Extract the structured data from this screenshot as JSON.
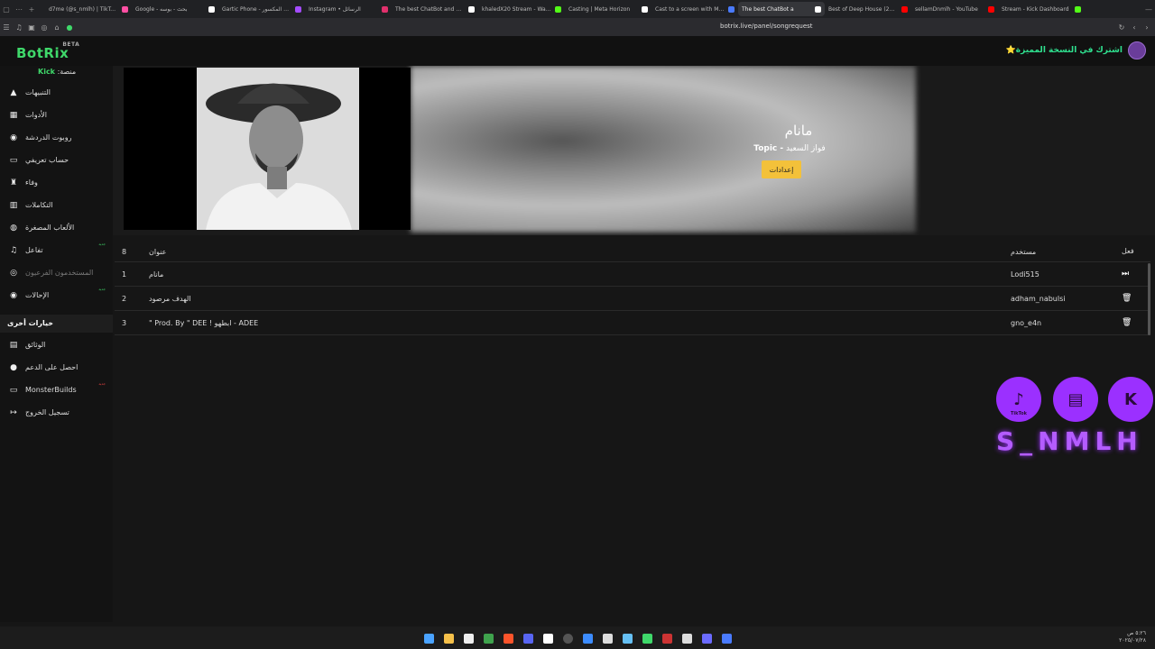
{
  "browser": {
    "tabs": [
      {
        "label": "d7me (@s_nmlh) | TikTok (5)",
        "color": "#ff4fa3"
      },
      {
        "label": "Google - بحث - بوسه",
        "color": "#ffffff"
      },
      {
        "label": "Gartic Phone - الهاتف المكسور",
        "color": "#a44cff"
      },
      {
        "label": "Instagram • الرسائل",
        "color": "#e1306c"
      },
      {
        "label": "The best ChatBot and Widg",
        "color": "#ffffff"
      },
      {
        "label": "khaledX20 Stream - Watch",
        "color": "#53fc18"
      },
      {
        "label": "Casting | Meta Horizon",
        "color": "#ffffff"
      },
      {
        "label": "Cast to a screen with Meta",
        "color": "#4a7bff"
      },
      {
        "label": "The best ChatBot a",
        "color": "#ffffff"
      },
      {
        "label": "Best of Deep House (2025)",
        "color": "#ff0000"
      },
      {
        "label": "sellamDnmlh - YouTube",
        "color": "#ff0000"
      },
      {
        "label": "Stream - Kick Dashboard",
        "color": "#53fc18"
      }
    ],
    "url": "botrix.live/panel/songrequest"
  },
  "header": {
    "logo": "BotRix",
    "beta": "BETA",
    "premium": "اشترك في النسخة المميزة⭐"
  },
  "sidebar": {
    "platform_label": "منصة:",
    "platform_value": "Kick",
    "items": [
      {
        "label": "التنبيهات",
        "icon": "alert-icon"
      },
      {
        "label": "الأدوات",
        "icon": "tools-icon"
      },
      {
        "label": "روبوت الدردشة",
        "icon": "robot-icon"
      },
      {
        "label": "حساب تعريفي",
        "icon": "profile-icon"
      },
      {
        "label": "وفاء",
        "icon": "trophy-icon"
      },
      {
        "label": "التكاملات",
        "icon": "integrations-icon"
      },
      {
        "label": "الألعاب المصغرة",
        "icon": "gamepad-icon"
      },
      {
        "label": "تفاعل",
        "icon": "music-icon",
        "badge": "جديد"
      },
      {
        "label": "المستخدمون الفرعيون",
        "icon": "users-icon",
        "dim": true
      },
      {
        "label": "الإحالات",
        "icon": "referral-icon",
        "badge": "جديد"
      }
    ],
    "other_header": "خيارات أخرى",
    "other_items": [
      {
        "label": "الوثائق",
        "icon": "docs-icon"
      },
      {
        "label": "احصل على الدعم",
        "icon": "support-icon"
      },
      {
        "label": "MonsterBuilds",
        "icon": "laptop-icon",
        "badge": "جديد"
      },
      {
        "label": "تسجيل الخروج",
        "icon": "logout-icon"
      }
    ]
  },
  "player": {
    "title": "مانام",
    "artist": "فواز السعيد",
    "artist_suffix": "- Topic",
    "settings_label": "إعدادات"
  },
  "table": {
    "headers": {
      "count": "8",
      "title": "عنوان",
      "user": "مستخدم",
      "action": "فعل"
    },
    "rows": [
      {
        "num": "1",
        "title": "مانام",
        "user": "Lodi515",
        "action_icon": "skip-icon"
      },
      {
        "num": "2",
        "title": "الهدف مرصود",
        "user": "adham_nabulsi",
        "action_icon": "trash-icon"
      },
      {
        "num": "3",
        "title": "ADEE - ابطهو ! Prod. By \" DEE \"",
        "user": "gno_e4n",
        "action_icon": "trash-icon"
      }
    ]
  },
  "overlay": {
    "handle": "S_NMLH",
    "tiktok_label": "TikTok",
    "icons": [
      "tiktok-icon",
      "twitch-icon",
      "kick-icon"
    ]
  },
  "taskbar": {
    "time": "٥:٢٦ ص",
    "date": "٢٠٢٥/٠٧/٢٨"
  }
}
